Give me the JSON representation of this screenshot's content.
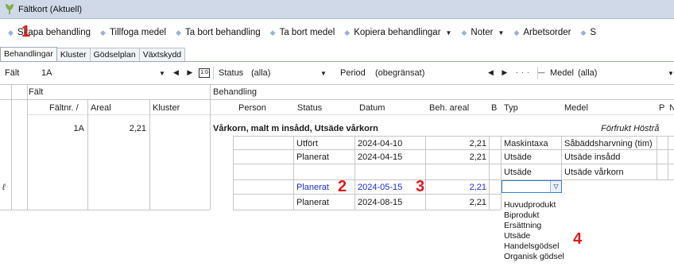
{
  "window": {
    "title": "Fältkort (Aktuell)"
  },
  "toolbar": {
    "items": [
      {
        "label": "Skapa behandling",
        "dropdown": false
      },
      {
        "label": "Tillfoga medel",
        "dropdown": false
      },
      {
        "label": "Ta bort behandling",
        "dropdown": false
      },
      {
        "label": "Ta bort medel",
        "dropdown": false
      },
      {
        "label": "Kopiera behandlingar",
        "dropdown": true
      },
      {
        "label": "Noter",
        "dropdown": true
      },
      {
        "label": "Arbetsorder",
        "dropdown": false
      },
      {
        "label": "S",
        "dropdown": false
      }
    ]
  },
  "tabs": [
    "Behandlingar",
    "Kluster",
    "Gödselplan",
    "Växtskydd"
  ],
  "filters": {
    "falt_label": "Fält",
    "falt_value": "1A",
    "status_label": "Status",
    "status_value": "(alla)",
    "period_label": "Period",
    "period_value": "(obegränsat)",
    "medel_label": "Medel",
    "medel_value": "(alla)",
    "nav_glyphs": "◀ ▶ ··· ",
    "nav_glyphs2": "◀ ▶ ··· —",
    "icon_text": "1:0"
  },
  "grid": {
    "group_headers": {
      "falt": "Fält",
      "behandling": "Behandling"
    },
    "columns": {
      "faltnr": "Fältnr. /",
      "areal": "Areal",
      "kluster": "Kluster",
      "person": "Person",
      "status": "Status",
      "datum": "Datum",
      "beh_areal": "Beh. areal",
      "b": "B",
      "typ": "Typ",
      "medel": "Medel",
      "p": "P",
      "n": "N"
    },
    "field_row": {
      "faltnr": "1A",
      "areal": "2,21"
    },
    "crop_title": "Vårkorn, malt m insådd, Utsäde vårkorn",
    "crop_note": "Förfrukt Höstrå",
    "rows": [
      {
        "status": "Utfört",
        "datum": "2024-04-10",
        "beh_areal": "2,21",
        "typ": "Maskintaxa",
        "medel": "Såbäddsharvning (tim)"
      },
      {
        "status": "Planerat",
        "datum": "2024-04-15",
        "beh_areal": "2,21",
        "typ": "Utsäde",
        "medel": "Utsäde insådd"
      },
      {
        "status": "",
        "datum": "",
        "beh_areal": "",
        "typ": "Utsäde",
        "medel": "Utsäde vårkorn"
      },
      {
        "status": "Planerat",
        "datum": "2024-05-15",
        "beh_areal": "2,21",
        "typ": "",
        "medel": ""
      },
      {
        "status": "Planerat",
        "datum": "2024-08-15",
        "beh_areal": "2,21",
        "typ": "",
        "medel": ""
      }
    ],
    "edit_marker": "ℓ"
  },
  "typ_dropdown": {
    "options": [
      "Huvudprodukt",
      "Biprodukt",
      "Ersättning",
      "Utsäde",
      "Handelsgödsel",
      "Organisk gödsel"
    ]
  },
  "annotations": [
    "1",
    "2",
    "3",
    "4"
  ],
  "colors": {
    "accent_blue": "#1a2fd1",
    "annotation_red": "#e01b1b",
    "titlebar": "#cfd9e8"
  }
}
